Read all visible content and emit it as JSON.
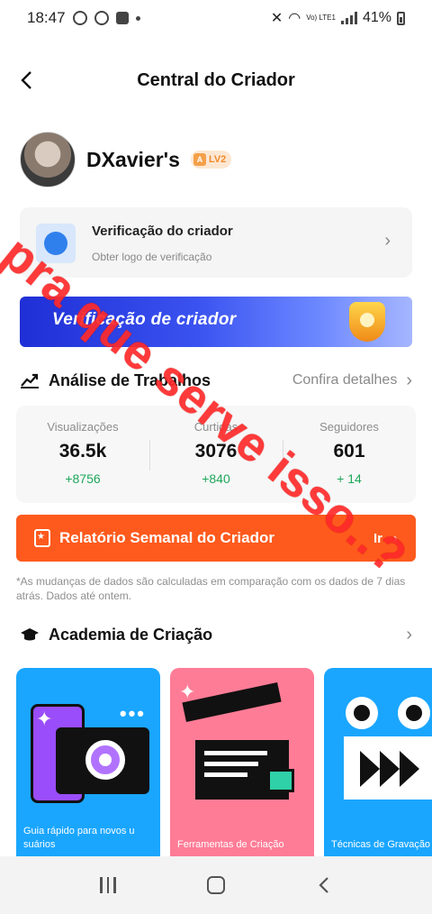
{
  "status_bar": {
    "time": "18:47",
    "battery": "41%",
    "network": "Vo) LTE1"
  },
  "header": {
    "title": "Central do Criador"
  },
  "profile": {
    "username": "DXavier's",
    "level_badge": "LV2"
  },
  "verification": {
    "title": "Verificação do criador",
    "subtitle": "Obter logo de verificação"
  },
  "banner": {
    "text": "Verificação de criador"
  },
  "analysis": {
    "title": "Análise de Trabalhos",
    "details_link": "Confira detalhes",
    "stats": [
      {
        "label": "Visualizações",
        "value": "36.5k",
        "delta": "+8756"
      },
      {
        "label": "Curtidas",
        "value": "3076",
        "delta": "+840"
      },
      {
        "label": "Seguidores",
        "value": "601",
        "delta": "+ 14"
      }
    ]
  },
  "weekly_report": {
    "label": "Relatório Semanal do Criador",
    "go_label": "Ir"
  },
  "note": "*As mudanças de dados são calculadas em comparação com os dados de 7 dias atrás. Dados até ontem.",
  "academy": {
    "title": "Academia de Criação",
    "cards": [
      {
        "label": "Guia rápido para novos u suários"
      },
      {
        "label": "Ferramentas de Criação"
      },
      {
        "label": "Técnicas de Gravação"
      }
    ]
  },
  "overlay": {
    "watermark_text": "pra que serve isso..?"
  },
  "colors": {
    "accent_orange": "#fe5a1d",
    "positive_green": "#1fa75b",
    "overlay_red": "#ff2a2a"
  }
}
